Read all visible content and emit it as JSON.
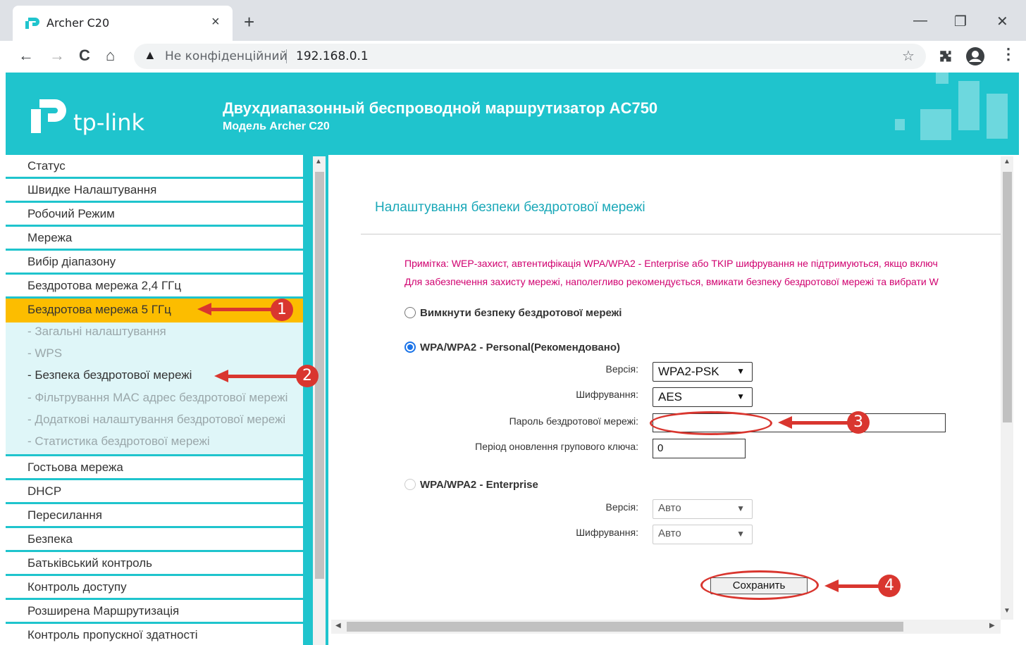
{
  "browser": {
    "tab_title": "Archer C20",
    "tab_close": "×",
    "new_tab": "+",
    "minimize": "—",
    "restore": "❐",
    "close": "✕",
    "back": "←",
    "forward": "→",
    "reload": "C",
    "home": "⌂",
    "not_secure": "Не конфіденційний",
    "url": "192.168.0.1",
    "star": "☆",
    "menu": "⋮"
  },
  "header": {
    "logo_text": "tp-link",
    "title": "Двухдиапазонный беспроводной маршрутизатор AC750",
    "subtitle": "Модель Archer C20",
    "brand_color": "#1fc4cd"
  },
  "sidebar": {
    "items_top": [
      "Статус",
      "Швидке Налаштування",
      "Робочий Режим",
      "Мережа",
      "Вибір діапазону",
      "Бездротова мережа 2,4 ГГц",
      "Бездротова мережа 5 ГГц"
    ],
    "sub_items": [
      "- Загальні налаштування",
      "- WPS",
      "- Безпека бездротової мережі",
      "- Фільтрування MAC адрес бездротової мережі",
      "- Додаткові налаштування бездротової мережі",
      "- Статистика бездротової мережі"
    ],
    "items_bottom": [
      "Гостьова мережа",
      "DHCP",
      "Пересилання",
      "Безпека",
      "Батьківський контроль",
      "Контроль доступу",
      "Розширена Маршрутизація",
      "Контроль пропускної здатності"
    ]
  },
  "main": {
    "title": "Налаштування безпеки бездротової мережі",
    "note_line1": "Примітка: WEP-захист, автентифікація WPA/WPA2 - Enterprise або TKIP шифрування не підтримуються, якщо включ",
    "note_line2": "Для забезпечення захисту мережі, наполегливо рекомендується, вмикати безпеку бездротової мережі та вибрати W",
    "option_disable": "Вимкнути безпеку бездротової мережі",
    "option_personal": "WPA/WPA2 - Personal(Рекомендовано)",
    "personal": {
      "version_label": "Версія:",
      "version_value": "WPA2-PSK",
      "encryption_label": "Шифрування:",
      "encryption_value": "AES",
      "password_label": "Пароль бездротової мережі:",
      "password_value": "",
      "group_key_label": "Період оновлення групового ключа:",
      "group_key_value": "0"
    },
    "option_enterprise": "WPA/WPA2 - Enterprise",
    "enterprise": {
      "version_label": "Версія:",
      "version_value": "Авто",
      "encryption_label": "Шифрування:",
      "encryption_value": "Авто"
    },
    "save_label": "Сохранить"
  },
  "annotations": {
    "badge1": "1",
    "badge2": "2",
    "badge3": "3",
    "badge4": "4",
    "color": "#d9362f"
  }
}
